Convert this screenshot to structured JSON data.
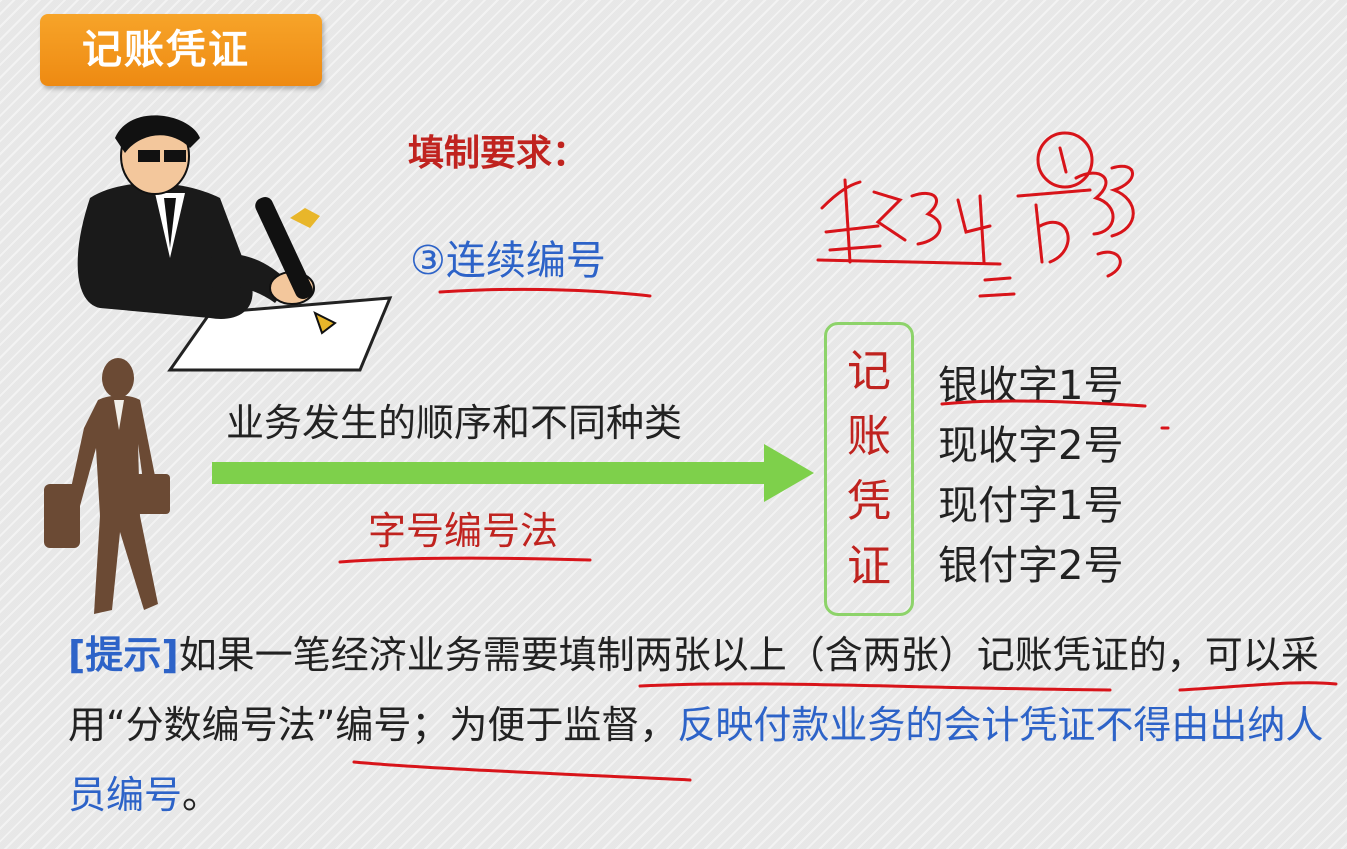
{
  "badge": {
    "title": "记账凭证"
  },
  "requirement": {
    "heading": "填制要求：",
    "item": "③连续编号"
  },
  "flow": {
    "label": "业务发生的顺序和不同种类",
    "method": "字号编号法"
  },
  "voucher": {
    "chars": [
      "记",
      "账",
      "凭",
      "证"
    ],
    "list": [
      "银收字1号",
      "现收字2号",
      "现付字1号",
      "银付字2号"
    ]
  },
  "tip": {
    "bracket": "[提示]",
    "text1": "如果一笔经济业务需要填制两张以上（含两张）记账凭证的，可以采用“分数编号法”编号；为便于监督，",
    "highlight": "反映付款业务的会计凭证不得由出纳人员编号",
    "end": "。"
  },
  "colors": {
    "badge": "#f08f16",
    "red": "#c0231f",
    "blue": "#2d63c8",
    "green_arrow": "#7ed04b",
    "box_border": "#8dd36a",
    "figure_brown": "#6b4a34"
  }
}
